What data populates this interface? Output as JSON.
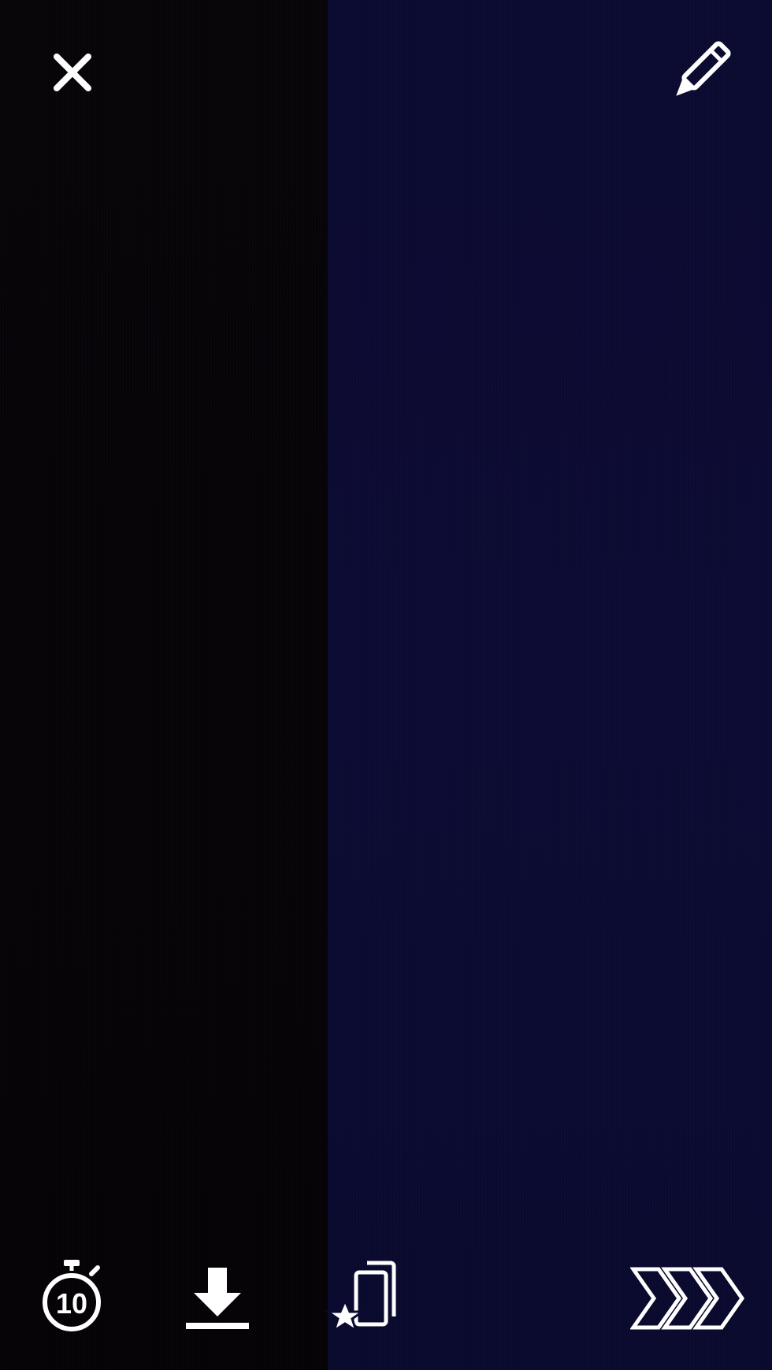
{
  "app": "snap-preview",
  "colors": {
    "left_panel": "#060407",
    "right_panel": "#0b0a31",
    "icon": "#ffffff"
  },
  "top_bar": {
    "close_icon": "close-icon",
    "edit_icon": "pencil-icon"
  },
  "bottom_bar": {
    "timer": {
      "icon": "stopwatch-icon",
      "value": "10"
    },
    "save_icon": "download-icon",
    "story_icon": "add-to-story-icon",
    "send_icon": "send-chevrons-icon"
  }
}
